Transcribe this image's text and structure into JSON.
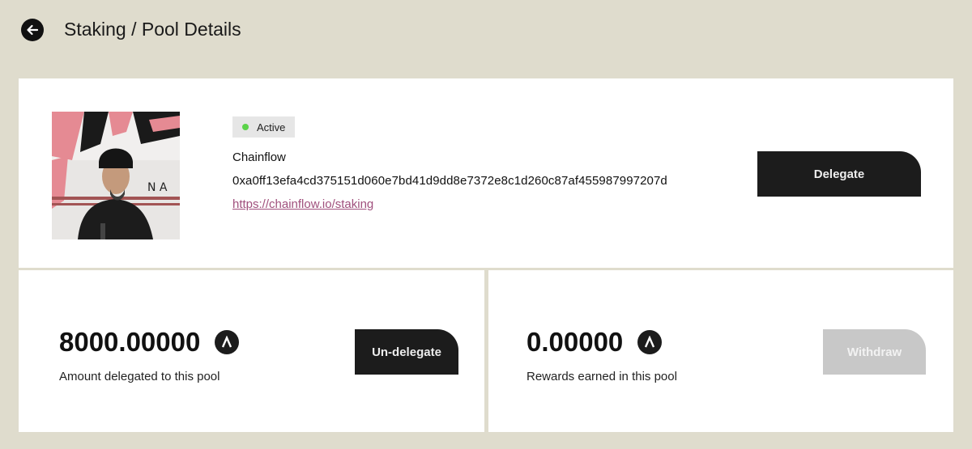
{
  "header": {
    "title": "Staking / Pool Details",
    "back_icon": "arrow-left-icon"
  },
  "pool": {
    "status": "Active",
    "status_color": "#5bd34a",
    "name": "Chainflow",
    "address": "0xa0ff13efa4cd375151d060e7bd41d9dd8e7372e8c1d260c87af455987997207d",
    "url": "https://chainflow.io/staking",
    "delegate_label": "Delegate"
  },
  "delegated": {
    "amount": "8000.00000",
    "caption": "Amount delegated to this pool",
    "button_label": "Un-delegate",
    "token_icon": "token-a-icon"
  },
  "rewards": {
    "amount": "0.00000",
    "caption": "Rewards earned in this pool",
    "button_label": "Withdraw",
    "button_state": "disabled",
    "token_icon": "token-a-icon"
  },
  "colors": {
    "background": "#dfdccd",
    "button_dark": "#1c1c1c",
    "button_disabled": "#c8c8c8",
    "link": "#a0507d"
  }
}
